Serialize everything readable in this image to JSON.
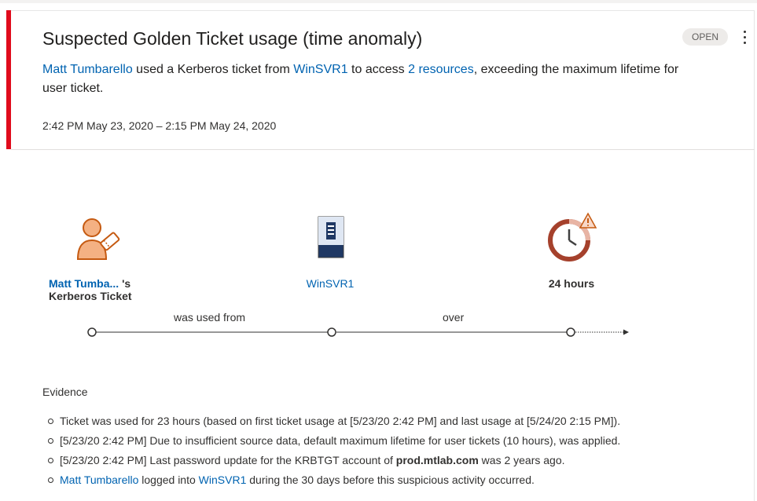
{
  "alert": {
    "title": "Suspected Golden Ticket usage (time anomaly)",
    "status": "OPEN",
    "accent_color": "#e00b1c",
    "description": {
      "user": "Matt Tumbarello",
      "text1": " used a Kerberos ticket from ",
      "host": "WinSVR1",
      "text2": " to access ",
      "resources": "2 resources",
      "text3": ", exceeding the maximum lifetime for user ticket."
    },
    "time_range": "2:42 PM May 23, 2020 – 2:15 PM May 24, 2020"
  },
  "diagram": {
    "node1": {
      "name": "Matt Tumba...",
      "suffix": " 's",
      "line2": "Kerberos Ticket",
      "icon": "user-ticket-icon"
    },
    "node2": {
      "name": "WinSVR1",
      "icon": "server-icon"
    },
    "node3": {
      "name": "24 hours",
      "icon": "clock-warning-icon"
    },
    "edge1": "was used from",
    "edge2": "over"
  },
  "evidence": {
    "title": "Evidence",
    "item1": "Ticket was used for 23 hours (based on first ticket usage at [5/23/20 2:42 PM] and last usage at [5/24/20 2:15 PM]).",
    "item2": "[5/23/20 2:42 PM] Due to insufficient source data, default maximum lifetime for user tickets (10 hours), was applied.",
    "item3_pre": "[5/23/20 2:42 PM] Last password update for the KRBTGT account of ",
    "item3_domain": "prod.mtlab.com",
    "item3_post": " was 2 years ago.",
    "item4_user": "Matt Tumbarello",
    "item4_mid": " logged into ",
    "item4_host": "WinSVR1",
    "item4_post": " during the 30 days before this suspicious activity occurred."
  }
}
